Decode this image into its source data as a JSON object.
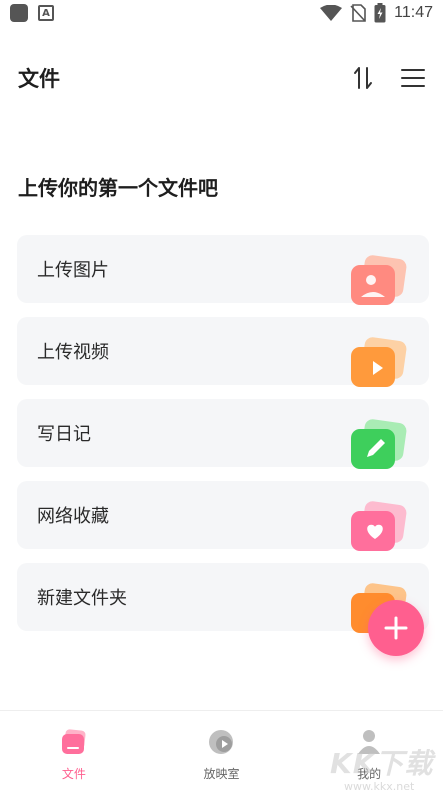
{
  "status_bar": {
    "time": "11:47",
    "notification_letter": "A"
  },
  "header": {
    "title": "文件"
  },
  "section": {
    "heading": "上传你的第一个文件吧"
  },
  "cards": [
    {
      "label": "上传图片",
      "icon": "image-icon",
      "colors": [
        "#ff8a80",
        "#ffb199"
      ]
    },
    {
      "label": "上传视频",
      "icon": "video-icon",
      "colors": [
        "#ff9a3c",
        "#ffc48a"
      ]
    },
    {
      "label": "写日记",
      "icon": "pencil-icon",
      "colors": [
        "#3ecf5c",
        "#8fe89e"
      ]
    },
    {
      "label": "网络收藏",
      "icon": "heart-icon",
      "colors": [
        "#ff6f9c",
        "#ffa7c2"
      ]
    },
    {
      "label": "新建文件夹",
      "icon": "folder-icon",
      "colors": [
        "#ff8c2e",
        "#ffb366"
      ]
    }
  ],
  "fab": {
    "icon": "plus-icon",
    "color": "#ff5f8f"
  },
  "bottom_nav": [
    {
      "label": "文件",
      "icon": "file-icon",
      "active": true
    },
    {
      "label": "放映室",
      "icon": "play-disc-icon",
      "active": false
    },
    {
      "label": "我的",
      "icon": "user-icon",
      "active": false
    }
  ],
  "watermark": {
    "text": "KK下载",
    "url": "www.kkx.net"
  },
  "accent_color": "#ff5f8f"
}
